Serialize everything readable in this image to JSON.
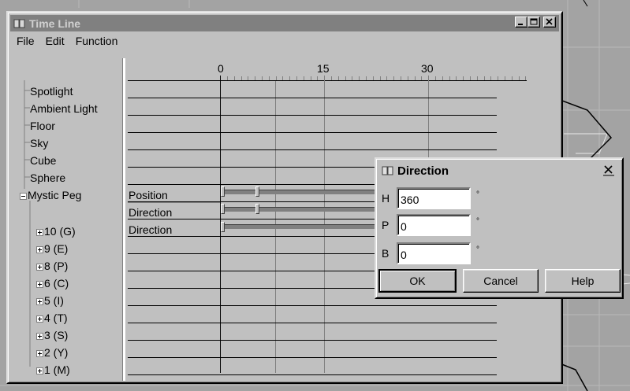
{
  "timeline": {
    "title": "Time Line",
    "menu": [
      "File",
      "Edit",
      "Function"
    ],
    "ruler": [
      "0",
      "15",
      "30"
    ],
    "tree": [
      {
        "label": "Spotlight"
      },
      {
        "label": "Ambient Light"
      },
      {
        "label": "Floor"
      },
      {
        "label": "Sky"
      },
      {
        "label": "Cube"
      },
      {
        "label": "Sphere"
      },
      {
        "label": "Mystic Peg"
      },
      {
        "label": "10 (G)"
      },
      {
        "label": "9 (E)"
      },
      {
        "label": "8 (P)"
      },
      {
        "label": "6 (C)"
      },
      {
        "label": "5 (I)"
      },
      {
        "label": "4 (T)"
      },
      {
        "label": "3 (S)"
      },
      {
        "label": "2 (Y)"
      },
      {
        "label": "1 (M)"
      }
    ],
    "tracks": [
      "Position",
      "Direction",
      "Direction"
    ]
  },
  "dialog": {
    "title": "Direction",
    "fields": [
      {
        "label": "H",
        "value": "360",
        "unit": "°"
      },
      {
        "label": "P",
        "value": "0",
        "unit": "°"
      },
      {
        "label": "B",
        "value": "0",
        "unit": "°"
      }
    ],
    "buttons": {
      "ok": "OK",
      "cancel": "Cancel",
      "help": "Help"
    }
  },
  "colors": {
    "face": "#c0c0c0",
    "inactive_title": "#808080"
  }
}
